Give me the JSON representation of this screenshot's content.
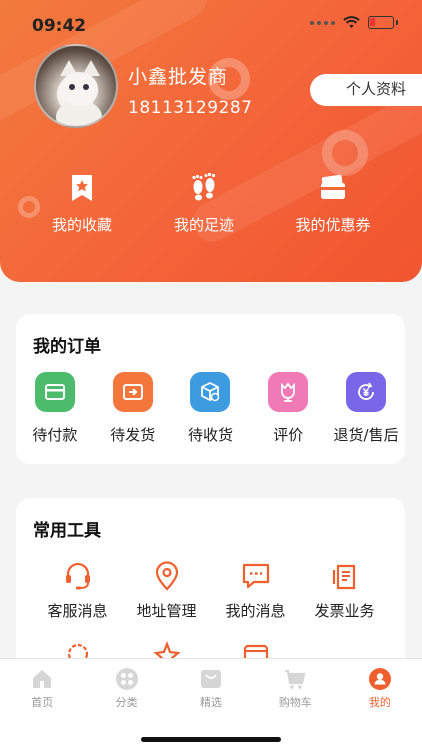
{
  "status_bar": {
    "time": "09:42"
  },
  "profile": {
    "name": "小鑫批发商",
    "phone": "18113129287",
    "profile_button": "个人资料"
  },
  "quick_links": [
    {
      "label": "我的收藏",
      "icon": "favorites-icon"
    },
    {
      "label": "我的足迹",
      "icon": "footprint-icon"
    },
    {
      "label": "我的优惠券",
      "icon": "coupon-icon"
    }
  ],
  "orders": {
    "title": "我的订单",
    "items": [
      {
        "label": "待付款",
        "icon": "card-icon",
        "color": "#4cbb6b"
      },
      {
        "label": "待发货",
        "icon": "ship-box-icon",
        "color": "#f5763a"
      },
      {
        "label": "待收货",
        "icon": "package-icon",
        "color": "#3d9be0"
      },
      {
        "label": "评价",
        "icon": "flower-icon",
        "color": "#f07ab6"
      },
      {
        "label": "退货/售后",
        "icon": "refund-icon",
        "color": "#7a66e8"
      }
    ]
  },
  "tools": {
    "title": "常用工具",
    "items": [
      {
        "label": "客服消息",
        "icon": "headset-icon"
      },
      {
        "label": "地址管理",
        "icon": "location-icon"
      },
      {
        "label": "我的消息",
        "icon": "message-icon"
      },
      {
        "label": "发票业务",
        "icon": "invoice-icon"
      }
    ]
  },
  "tabbar": {
    "items": [
      {
        "label": "首页",
        "icon": "home-icon"
      },
      {
        "label": "分类",
        "icon": "category-icon"
      },
      {
        "label": "精选",
        "icon": "featured-icon"
      },
      {
        "label": "购物车",
        "icon": "cart-icon"
      },
      {
        "label": "我的",
        "icon": "profile-icon",
        "active": true
      }
    ]
  },
  "colors": {
    "accent": "#f0602f",
    "header": "#f4643a"
  }
}
